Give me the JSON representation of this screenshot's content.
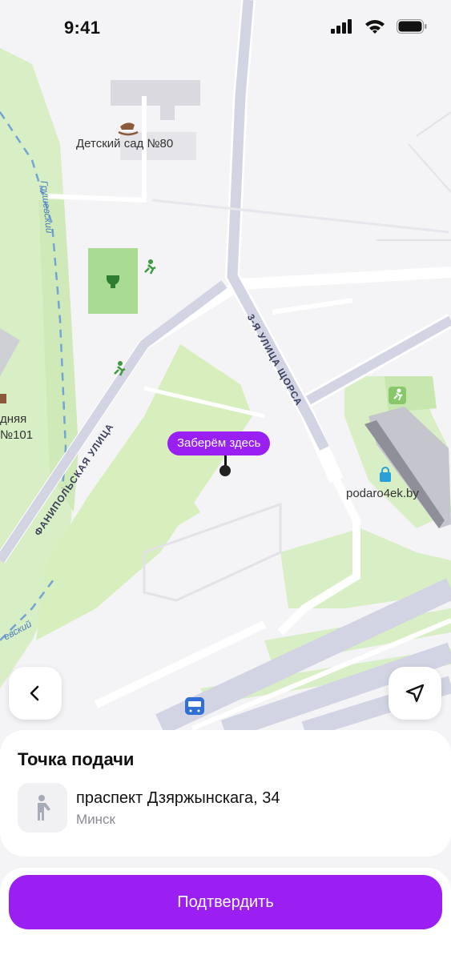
{
  "status_bar": {
    "time": "9:41"
  },
  "map": {
    "labels": {
      "kindergarten": "Детский сад №80",
      "school_fragment_1": "дняя",
      "school_fragment_2": "№101",
      "shop": "podaro4ek.by",
      "street_fanipolskaya": "ФАНИПОЛЬСКАЯ УЛИЦА",
      "street_shorsa": "3-Я УЛИЦА ЩОРСА",
      "river_1": "Грушевский",
      "river_2": "евский"
    },
    "pin_label": "Заберём здесь",
    "accent_color": "#9a1ff2"
  },
  "controls": {
    "back_icon": "chevron-left-icon",
    "locate_icon": "navigation-arrow-icon"
  },
  "pickup": {
    "title": "Точка подачи",
    "address": "праспект Дзяржынскага, 34",
    "city": "Минск",
    "icon": "standing-person-icon"
  },
  "actions": {
    "confirm_label": "Подтвердить"
  }
}
